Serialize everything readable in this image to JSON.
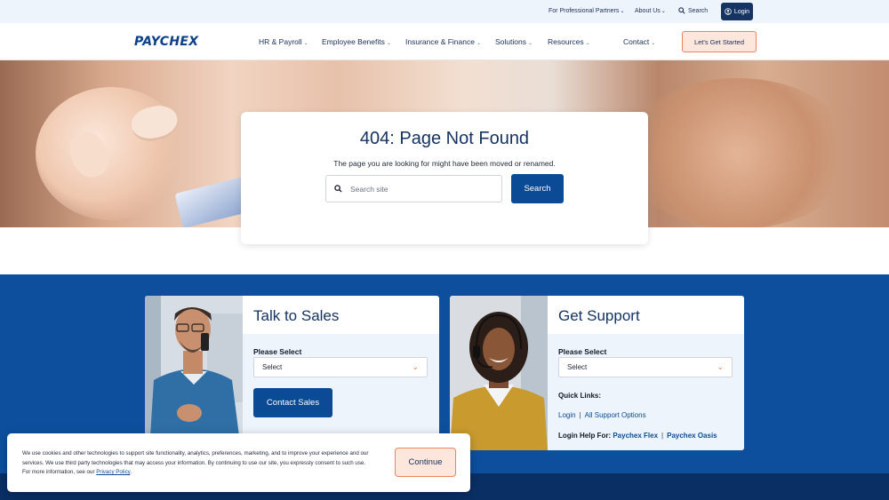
{
  "utility_bar": {
    "partners_label": "For Professional Partners",
    "about_label": "About Us",
    "search_label": "Search",
    "login_label": "Login"
  },
  "nav": {
    "logo": "PAYCHEX",
    "items": [
      {
        "label": "HR & Payroll"
      },
      {
        "label": "Employee Benefits"
      },
      {
        "label": "Insurance & Finance"
      },
      {
        "label": "Solutions"
      },
      {
        "label": "Resources"
      },
      {
        "label": "Contact"
      }
    ],
    "cta_label": "Let's Get Started"
  },
  "error_card": {
    "title": "404: Page Not Found",
    "message": "The page you are looking for might have been moved or renamed.",
    "search_placeholder": "Search site",
    "search_button": "Search"
  },
  "sales_panel": {
    "title": "Talk to Sales",
    "select_label": "Please Select",
    "select_value": "Select",
    "button_label": "Contact Sales"
  },
  "support_panel": {
    "title": "Get Support",
    "select_label": "Please Select",
    "select_value": "Select",
    "quick_links_title": "Quick Links:",
    "quick_links": [
      "Login",
      "All Support Options"
    ],
    "login_help_label": "Login Help For:",
    "login_help_links": [
      "Paychex Flex",
      "Paychex Oasis"
    ]
  },
  "cookie_banner": {
    "text": "We use cookies and other technologies to support site functionality, analytics, preferences, marketing, and to improve your experience and our services. We use third party technologies that may access your information. By continuing to use our site, you expressly consent to such use. For more information, see our",
    "policy_link": "Privacy Policy",
    "button_label": "Continue"
  },
  "colors": {
    "brand_navy": "#153462",
    "brand_blue": "#0b4a94",
    "section_blue": "#0d4f9d",
    "accent_peach": "#fde6dc",
    "accent_orange": "#e9855f"
  }
}
